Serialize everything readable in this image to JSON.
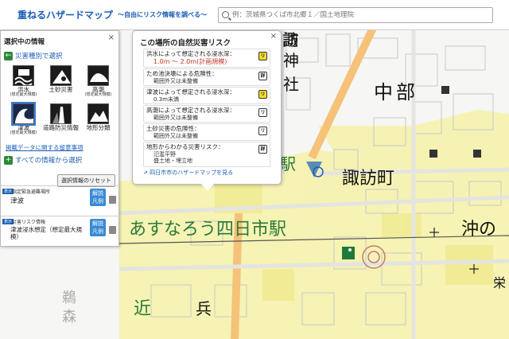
{
  "header": {
    "title": "重ねるハザードマップ",
    "subtitle": "～自由にリスク情報を調べる～",
    "search_placeholder": "例：茨城県つくば市北郷１／国土地理院",
    "search_icon": "search-icon"
  },
  "panel": {
    "title": "選択中の情報",
    "close": "×",
    "category_link": "災害種別で選択",
    "hazards": [
      {
        "label": "洪水",
        "sub": "(想定最大規模)",
        "icon": "flood-icon",
        "active": false
      },
      {
        "label": "土砂災害",
        "sub": "",
        "icon": "landslide-icon",
        "active": false
      },
      {
        "label": "高潮",
        "sub": "(想定最大規模)",
        "icon": "storm-surge-icon",
        "active": false
      },
      {
        "label": "津波",
        "sub": "(想定最大規模)",
        "icon": "tsunami-icon",
        "active": true
      },
      {
        "label": "道路防災情報",
        "sub": "",
        "icon": "road-icon",
        "active": false
      },
      {
        "label": "地形分類",
        "sub": "",
        "icon": "terrain-icon",
        "active": false
      }
    ],
    "notice_link": "掲載データに関する留意事項",
    "all_info_link": "すべての情報から選択",
    "reset_button": "選択情報のリセット",
    "layers": [
      {
        "tag": "表示",
        "caption": "指定緊急避難場所",
        "name": "津波",
        "legend": "解説凡例"
      },
      {
        "tag": "表示",
        "caption": "災害リスク情報",
        "name": "津波浸水想定（想定最大規模）",
        "legend": "解説凡例"
      }
    ]
  },
  "popup": {
    "title": "この場所の自然災害リスク",
    "close": "×",
    "risks": [
      {
        "question": "洪水によって想定される浸水深：",
        "answer": [
          "1.0m ～ 2.0m(計画規模)"
        ],
        "highlight": true,
        "badge": "リ",
        "badge_yellow": true
      },
      {
        "question": "ため池決壊による危険性：",
        "answer": [
          "範囲外又は未整備"
        ],
        "highlight": false,
        "badge": "詳",
        "badge_yellow": false
      },
      {
        "question": "津波によって想定される浸水深：",
        "answer": [
          "0.3m未満"
        ],
        "highlight": false,
        "badge": "リ",
        "badge_yellow": true
      },
      {
        "question": "高潮によって想定される浸水深：",
        "answer": [
          "範囲外又は未整備"
        ],
        "highlight": false,
        "badge": "リ",
        "badge_yellow": false
      },
      {
        "question": "土砂災害の危険性：",
        "answer": [
          "範囲外又は未整備"
        ],
        "highlight": false,
        "badge": "リ",
        "badge_yellow": false
      },
      {
        "question": "地形からわかる災害リスク：",
        "answer": [
          "氾濫平野",
          "盛土地・埋立地"
        ],
        "highlight": false,
        "badge": "詳",
        "badge_yellow": false
      }
    ],
    "hazard_map_link": "四日市市のハザードマップを見る"
  },
  "map": {
    "labels": [
      {
        "text": "諏",
        "size": 20
      },
      {
        "text": "訪",
        "size": 20
      },
      {
        "text": "神",
        "size": 20
      },
      {
        "text": "社",
        "size": 20
      },
      {
        "text": "中部",
        "size": 24
      },
      {
        "text": "駅",
        "size": 20
      },
      {
        "text": "諏訪町",
        "size": 22
      },
      {
        "text": "あすなろう四日市駅",
        "size": 22
      },
      {
        "text": "沖の",
        "size": 22
      },
      {
        "text": "近",
        "size": 22
      },
      {
        "text": "兵",
        "size": 20
      },
      {
        "text": "栄",
        "size": 16
      },
      {
        "text": "鵜",
        "size": 18
      },
      {
        "text": "森",
        "size": 18
      }
    ]
  },
  "colors": {
    "accent": "#1a5fb4",
    "road_orange": "#f5c27a",
    "flood_yellow": "#f6f2a8",
    "station_green": "#2a7a3a"
  }
}
